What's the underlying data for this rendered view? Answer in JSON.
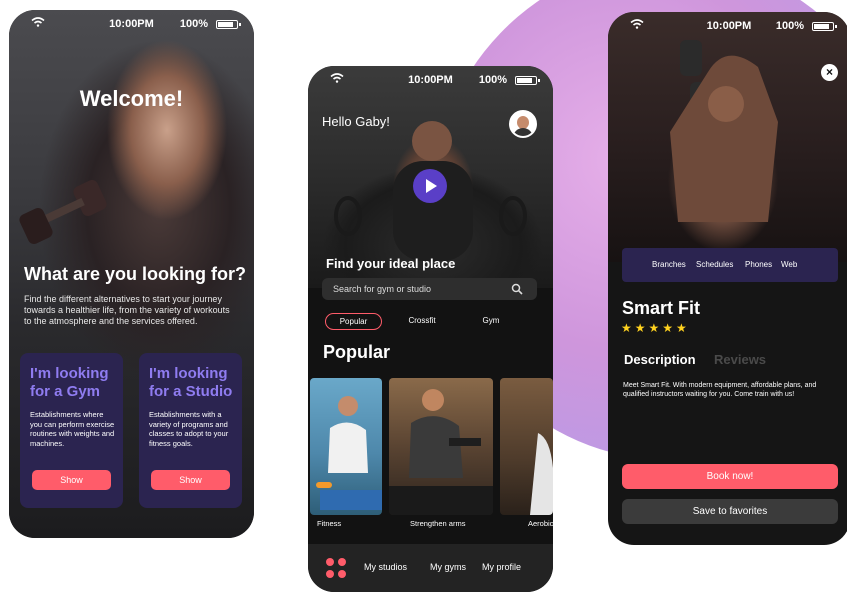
{
  "status": {
    "time": "10:00PM",
    "battery": "100%"
  },
  "welcome_screen": {
    "title": "Welcome!",
    "question": "What are you looking for?",
    "description": "Find the different alternatives to start your journey towards a healthier life, from the variety of workouts to the atmosphere and the services offered.",
    "cards": [
      {
        "title": "I'm looking for a Gym",
        "text": "Establishments where you can perform exercise routines with weights and machines.",
        "button": "Show"
      },
      {
        "title": "I'm looking for a Studio",
        "text": "Establishments with a variety of programs and classes to adopt to your fitness goals.",
        "button": "Show"
      }
    ]
  },
  "home_screen": {
    "greeting": "Hello Gaby!",
    "headline": "Find your ideal place",
    "search_placeholder": "Search for gym or studio",
    "chips": [
      "Popular",
      "Crossfit",
      "Gym"
    ],
    "section_title": "Popular",
    "tiles": [
      "Fitness",
      "Strengthen arms",
      "Aerobic"
    ],
    "nav": [
      "My studios",
      "My gyms",
      "My profile"
    ]
  },
  "detail_screen": {
    "tabs": [
      "Branches",
      "Schedules",
      "Phones",
      "Web"
    ],
    "name": "Smart Fit",
    "stars": "★★★★★",
    "rating": 5,
    "content_tabs": [
      "Description",
      "Reviews"
    ],
    "description": "Meet Smart Fit. With modern equipment, affordable plans, and qualified instructors waiting for you. Come train with us!",
    "book_button": "Book now!",
    "save_button": "Save to favorites",
    "close_glyph": "×"
  },
  "colors": {
    "accent": "#ff5c6a",
    "purple": "#2b2450",
    "purple_text": "#8f7cf0",
    "star": "#ffd21f"
  }
}
